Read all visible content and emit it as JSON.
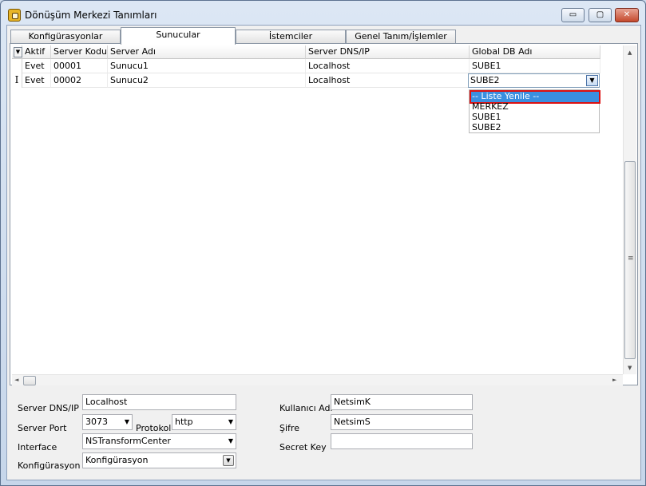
{
  "window": {
    "title": "Dönüşüm Merkezi Tanımları",
    "controls": {
      "minimize": "▭",
      "maximize": "▢",
      "close": "✕"
    }
  },
  "tabs": [
    {
      "label": "Konfigürasyonlar",
      "active": false
    },
    {
      "label": "Sunucular",
      "active": true
    },
    {
      "label": "İstemciler",
      "active": false
    },
    {
      "label": "Genel Tanım/İşlemler",
      "active": false
    }
  ],
  "grid": {
    "header_menu_glyph": "▼",
    "columns": [
      "Aktif",
      "Server Kodu",
      "Server Adı",
      "Server DNS/IP",
      "Global DB Adı"
    ],
    "rows": [
      {
        "indicator": "",
        "cells": [
          "Evet",
          "00001",
          "Sunucu1",
          "Localhost",
          "SUBE1"
        ]
      },
      {
        "indicator": "I",
        "cells": [
          "Evet",
          "00002",
          "Sunucu2",
          "Localhost",
          ""
        ]
      }
    ],
    "editor": {
      "value": "SUBE2",
      "dropdown_glyph": "▼"
    },
    "dropdown_options": [
      "-- Liste Yenile --",
      "MERKEZ",
      "SUBE1",
      "SUBE2"
    ],
    "dropdown_selected_index": 0
  },
  "scrollbars": {
    "up": "▲",
    "down": "▼",
    "left": "◄",
    "right": "►",
    "grip": "≡"
  },
  "form": {
    "server_dns_label": "Server DNS/IP",
    "server_dns_value": "Localhost",
    "server_port_label": "Server Port",
    "server_port_value": "3073",
    "protocol_label": "Protokol",
    "protocol_value": "http",
    "interface_label": "Interface",
    "interface_value": "NSTransformCenter",
    "konfig_label": "Konfigürasyon",
    "konfig_value": "Konfigürasyon",
    "user_label": "Kullanıcı Adı",
    "user_value": "NetsimK",
    "password_label": "Şifre",
    "password_value": "NetsimS",
    "secret_label": "Secret Key",
    "secret_value": "",
    "select_glyph": "▼"
  },
  "colors": {
    "selection": "#3a8fe0",
    "selection_outline": "#dd1010",
    "frame": "#c6d6ea"
  }
}
